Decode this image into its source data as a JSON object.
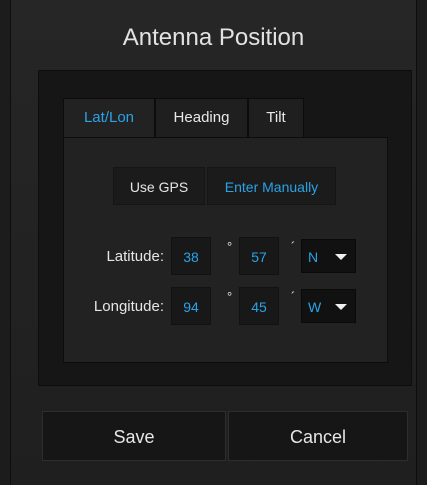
{
  "dialog": {
    "title": "Antenna Position"
  },
  "tabs": [
    {
      "label": "Lat/Lon",
      "active": true
    },
    {
      "label": "Heading",
      "active": false
    },
    {
      "label": "Tilt",
      "active": false
    }
  ],
  "mode": {
    "use_gps_label": "Use GPS",
    "enter_manually_label": "Enter Manually",
    "selected": "Enter Manually"
  },
  "latitude": {
    "label": "Latitude:",
    "degrees": "38",
    "minutes": "57",
    "hemisphere": "N"
  },
  "longitude": {
    "label": "Longitude:",
    "degrees": "94",
    "minutes": "45",
    "hemisphere": "W"
  },
  "symbols": {
    "degree": "°",
    "minute": "´"
  },
  "buttons": {
    "save_label": "Save",
    "cancel_label": "Cancel"
  },
  "colors": {
    "accent": "#2aa3e6",
    "background": "#1c1c1c",
    "panel": "#161616"
  }
}
